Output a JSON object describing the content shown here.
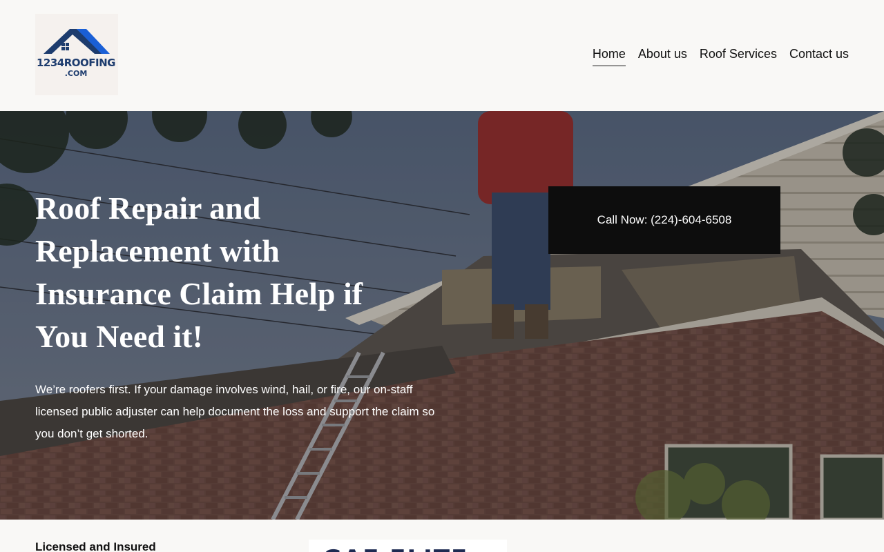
{
  "brand": {
    "logo_line1": "1234ROOFING",
    "logo_line2": ".COM",
    "colors": {
      "navy": "#1d3c6e",
      "blue": "#1a5fd6"
    }
  },
  "nav": {
    "items": [
      {
        "label": "Home",
        "active": true
      },
      {
        "label": "About us",
        "active": false
      },
      {
        "label": "Roof Services",
        "active": false
      },
      {
        "label": "Contact us",
        "active": false
      }
    ]
  },
  "hero": {
    "title": "Roof Repair and Replacement with Insurance Claim Help if You Need it!",
    "text": "We’re roofers first. If your damage involves wind, hail, or fire, our on-staff licensed public adjuster can help document the loss and support the claim so you don’t get shorted.",
    "cta": "Call Now: (224)-604-6508"
  },
  "below": {
    "licensed_heading": "Licensed and Insured",
    "badge_partial": "GAF ELITE"
  }
}
